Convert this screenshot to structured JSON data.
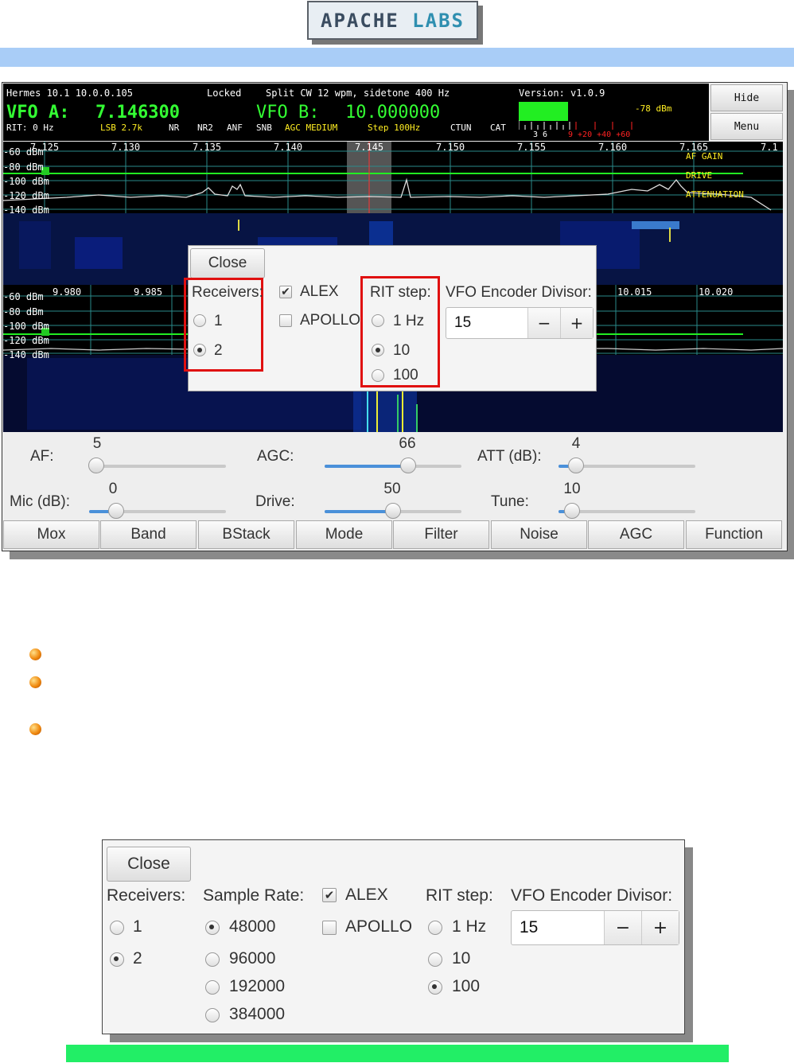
{
  "logo": {
    "part1": "APACHE",
    "part2": "LABS"
  },
  "status": {
    "radio": "Hermes 10.1 10.0.0.105",
    "lock": "Locked",
    "split": "Split CW 12 wpm, sidetone 400 Hz",
    "version": "Version: v1.0.9",
    "vfo_a_label": "VFO A:",
    "vfo_a_freq": "7.146300",
    "vfo_b_label": "VFO B:",
    "vfo_b_freq": "10.000000",
    "rit": "RIT: 0 Hz",
    "mode": "LSB 2.7k",
    "nr": "NR",
    "nr2": "NR2",
    "anf": "ANF",
    "snb": "SNB",
    "agc": "AGC MEDIUM",
    "step": "Step 100Hz",
    "ctun": "CTUN",
    "cat": "CAT",
    "dbm": "-78 dBm",
    "meter_scale_white": "3   6",
    "meter_scale_red": "9 +20 +40 +60",
    "hide": "Hide",
    "menu": "Menu"
  },
  "spectrum1": {
    "freqs": [
      "7.125",
      "7.130",
      "7.135",
      "7.140",
      "7.145",
      "7.150",
      "7.155",
      "7.160",
      "7.165",
      "7.1"
    ],
    "dbm": [
      "-60 dBm",
      "-80 dBm",
      "-100 dBm",
      "-120 dBm",
      "-140 dBm"
    ],
    "af_gain": "AF GAIN",
    "drive": "DRIVE",
    "attenuation": "ATTENUATION"
  },
  "spectrum2": {
    "freqs": [
      "9.980",
      "9.985",
      "10.015",
      "10.020"
    ],
    "dbm": [
      "-60 dBm",
      "-80 dBm",
      "-100 dBm",
      "-120 dBm",
      "-140 dBm"
    ]
  },
  "dialog": {
    "close": "Close",
    "receivers_label": "Receivers:",
    "receivers": [
      "1",
      "2"
    ],
    "alex": "ALEX",
    "apollo": "APOLLO",
    "rit_label": "RIT step:",
    "rit": [
      "1 Hz",
      "10",
      "100"
    ],
    "vfo_label": "VFO Encoder Divisor:",
    "vfo_value": "15",
    "minus": "−",
    "plus": "+"
  },
  "controls": {
    "af_label": "AF:",
    "af_value": "5",
    "af_pct": 0.05,
    "agc_label": "AGC:",
    "agc_value": "66",
    "agc_pct": 0.61,
    "att_label": "ATT (dB):",
    "att_value": "4",
    "att_pct": 0.13,
    "mic_label": "Mic (dB):",
    "mic_value": "0",
    "mic_pct": 0.2,
    "drive_label": "Drive:",
    "drive_value": "50",
    "drive_pct": 0.5,
    "tune_label": "Tune:",
    "tune_value": "10",
    "tune_pct": 0.1
  },
  "buttons": [
    "Mox",
    "Band",
    "BStack",
    "Mode",
    "Filter",
    "Noise",
    "AGC",
    "Function"
  ],
  "dialog2": {
    "close": "Close",
    "receivers_label": "Receivers:",
    "receivers": [
      "1",
      "2"
    ],
    "sample_label": "Sample Rate:",
    "sample_rates": [
      "48000",
      "96000",
      "192000",
      "384000"
    ],
    "alex": "ALEX",
    "apollo": "APOLLO",
    "rit_label": "RIT step:",
    "rit": [
      "1 Hz",
      "10",
      "100"
    ],
    "vfo_label": "VFO Encoder Divisor:",
    "vfo_value": "15",
    "minus": "−",
    "plus": "+"
  },
  "colors": {
    "vfo_green": "#33ff33",
    "yellow": "#ffee22",
    "highlight_red": "#e01010",
    "top_bar": "#a9cdf7",
    "bottom_bar": "#22ee66"
  }
}
